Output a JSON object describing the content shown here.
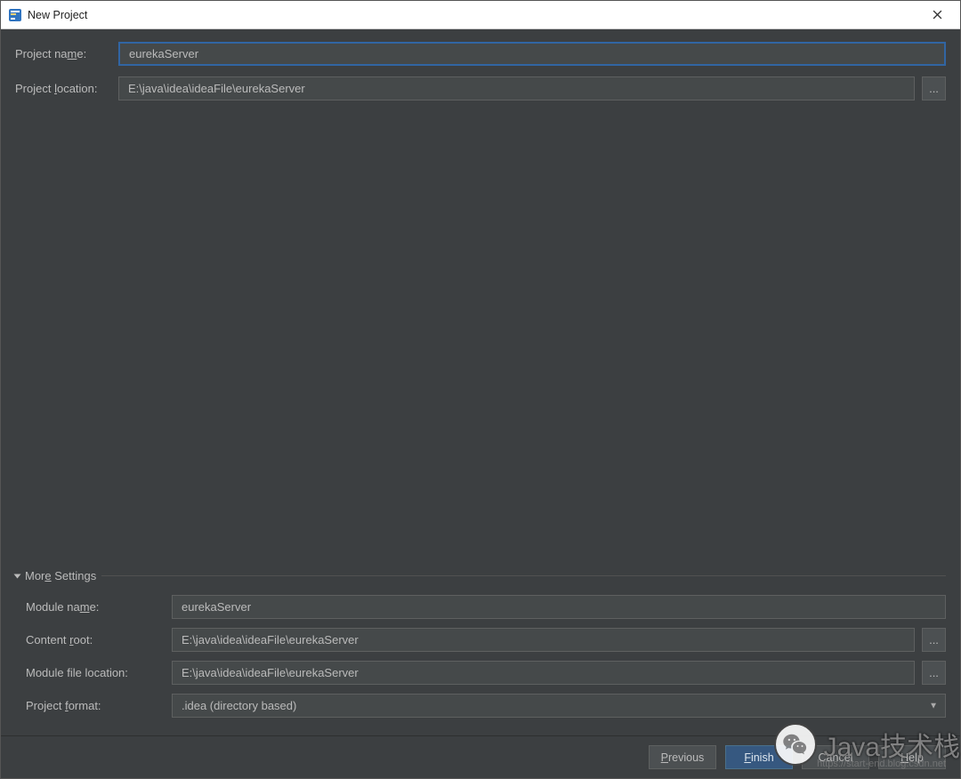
{
  "window": {
    "title": "New Project"
  },
  "fields": {
    "project_name": {
      "label_pre": "Project na",
      "label_mn": "m",
      "label_post": "e:",
      "value": "eurekaServer"
    },
    "project_location": {
      "label_pre": "Project ",
      "label_mn": "l",
      "label_post": "ocation:",
      "value": "E:\\java\\idea\\ideaFile\\eurekaServer",
      "browse": "..."
    }
  },
  "more": {
    "title_pre": "Mor",
    "title_mn": "e",
    "title_post": " Settings",
    "module_name": {
      "label_pre": "Module na",
      "label_mn": "m",
      "label_post": "e:",
      "value": "eurekaServer"
    },
    "content_root": {
      "label_pre": "Content ",
      "label_mn": "r",
      "label_post": "oot:",
      "value": "E:\\java\\idea\\ideaFile\\eurekaServer",
      "browse": "..."
    },
    "module_file_location": {
      "label": "Module file location:",
      "value": "E:\\java\\idea\\ideaFile\\eurekaServer",
      "browse": "..."
    },
    "project_format": {
      "label_pre": "Project ",
      "label_mn": "f",
      "label_post": "ormat:",
      "value": ".idea (directory based)"
    }
  },
  "buttons": {
    "previous": {
      "mn": "P",
      "post": "revious"
    },
    "finish": {
      "mn": "F",
      "post": "inish"
    },
    "cancel": "Cancel",
    "help": {
      "pre": "",
      "mn": "H",
      "post": "elp"
    }
  },
  "watermark": {
    "text": "Java技术栈",
    "sub": "https://start-end.blog.csdn.net"
  }
}
